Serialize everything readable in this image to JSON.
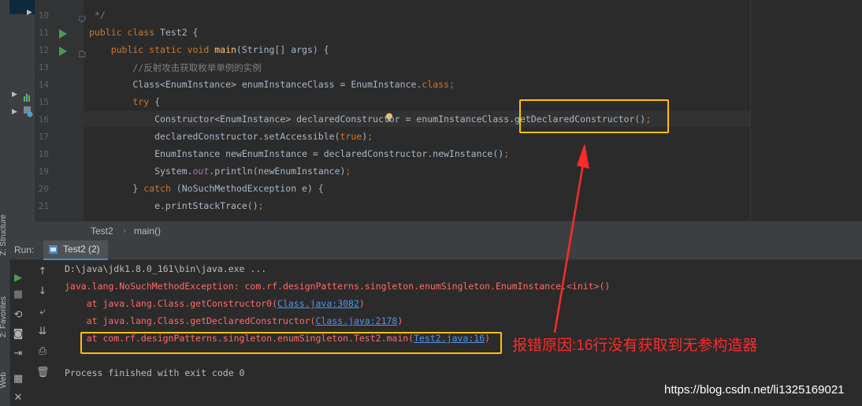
{
  "side_labels": {
    "structure": "Z: Structure",
    "favorites": "2: Favorites",
    "web": "Web"
  },
  "editor": {
    "lines": [
      {
        "n": "10",
        "text": " */"
      },
      {
        "n": "11",
        "parts": [
          [
            "kw",
            "public class "
          ],
          [
            "",
            "Test2 {"
          ]
        ]
      },
      {
        "n": "12",
        "parts": [
          [
            "kw",
            "    public static void "
          ],
          [
            "fn",
            "main"
          ],
          [
            "",
            "(String[] args) {"
          ]
        ]
      },
      {
        "n": "13",
        "text": "        //反射攻击获取枚举单例的实例"
      },
      {
        "n": "14",
        "parts": [
          [
            "",
            "        Class<EnumInstance> enumInstanceClass = EnumInstance."
          ],
          [
            "kw",
            "class"
          ],
          [
            "pu",
            ";"
          ]
        ]
      },
      {
        "n": "15",
        "parts": [
          [
            "kw",
            "        try "
          ],
          [
            "",
            "{"
          ]
        ]
      },
      {
        "n": "16",
        "parts": [
          [
            "",
            "            Constructor<EnumInstance> declaredConstructor = enumInstanceClass.getDeclaredConstructor()"
          ],
          [
            "pu",
            ";"
          ]
        ]
      },
      {
        "n": "17",
        "parts": [
          [
            "",
            "            declaredConstructor.setAccessible("
          ],
          [
            "kw",
            "true"
          ],
          [
            "",
            ")"
          ],
          [
            "pu",
            ";"
          ]
        ]
      },
      {
        "n": "18",
        "parts": [
          [
            "",
            "            EnumInstance newEnumInstance = declaredConstructor.newInstance()"
          ],
          [
            "pu",
            ";"
          ]
        ]
      },
      {
        "n": "19",
        "parts": [
          [
            "",
            "            System."
          ],
          [
            "it",
            "out"
          ],
          [
            "",
            ".println(newEnumInstance)"
          ],
          [
            "pu",
            ";"
          ]
        ]
      },
      {
        "n": "20",
        "parts": [
          [
            "",
            "        } "
          ],
          [
            "kw",
            "catch "
          ],
          [
            "",
            "(NoSuchMethodException e) {"
          ]
        ]
      },
      {
        "n": "21",
        "parts": [
          [
            "",
            "            e.printStackTrace()"
          ],
          [
            "pu",
            ";"
          ]
        ]
      }
    ]
  },
  "breadcrumb": {
    "class": "Test2",
    "method": "main()"
  },
  "run": {
    "label": "Run:",
    "tab": "Test2 (2)"
  },
  "console": {
    "cmd": "D:\\java\\jdk1.8.0_161\\bin\\java.exe ...",
    "exception": "java.lang.NoSuchMethodException: com.rf.designPatterns.singleton.enumSingleton.EnumInstance.<init>()",
    "at1_prefix": "    at java.lang.Class.getConstructor0(",
    "at1_link": "Class.java:3082",
    "at1_suffix": ")",
    "at2_prefix": "    at java.lang.Class.getDeclaredConstructor(",
    "at2_link": "Class.java:2178",
    "at2_suffix": ")",
    "at3_prefix": "    at com.rf.designPatterns.singleton.enumSingleton.Test2.main(",
    "at3_link": "Test2.java:16",
    "at3_suffix": ")",
    "finished": "Process finished with exit code 0"
  },
  "annotation": {
    "note": "报错原因:16行没有获取到无参构造器",
    "note_color": "#ff2a2a",
    "box_color": "#ffc000"
  },
  "watermark": "https://blog.csdn.net/li1325169021"
}
